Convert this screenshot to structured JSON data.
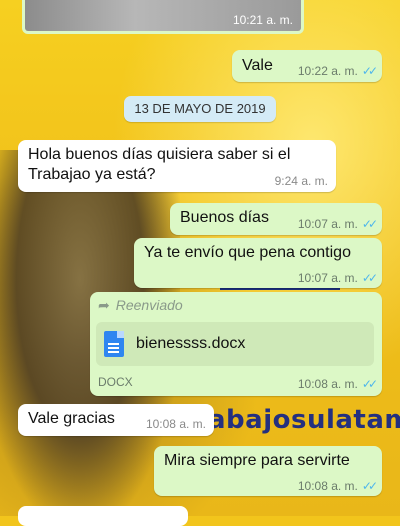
{
  "chat": {
    "top_image_time": "10:21 a. m.",
    "msg_vale": {
      "text": "Vale",
      "time": "10:22 a. m."
    },
    "date_separator": "13 DE MAYO DE 2019",
    "msg_hola": {
      "text_line1": "Hola buenos días quisiera saber si el",
      "text_line2": "Trabajao ya está?",
      "time": "9:24 a. m."
    },
    "msg_buenos": {
      "text": "Buenos días",
      "time": "10:07 a. m."
    },
    "msg_envio": {
      "text": "Ya te envío que pena contigo",
      "time": "10:07 a. m."
    },
    "msg_doc": {
      "forwarded_label": "Reenviado",
      "filename": "bienessss.docx",
      "filetype": "DOCX",
      "time": "10:08 a. m."
    },
    "msg_gracias": {
      "text": "Vale gracias",
      "time": "10:08 a. m."
    },
    "msg_mira": {
      "text": "Mira siempre para servirte",
      "time": "10:08 a. m."
    }
  },
  "background": {
    "watermark_text": "abajosulatam"
  },
  "icons": {
    "read_receipt": "double-check-icon",
    "forward": "forward-arrow-icon",
    "document": "document-icon"
  },
  "colors": {
    "outgoing_bubble": "#dcf8c6",
    "incoming_bubble": "#ffffff",
    "read_ticks": "#4fb6ec",
    "date_chip": "#d4ebf6",
    "wallpaper": "#f2c51c"
  }
}
